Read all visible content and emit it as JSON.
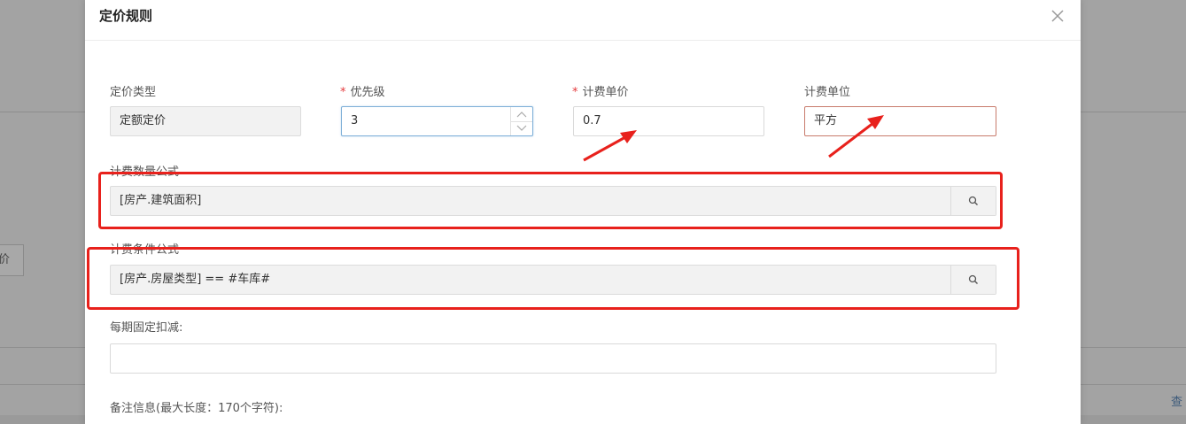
{
  "dialog": {
    "title": "定价规则",
    "close_icon": "close-icon"
  },
  "form": {
    "pricing_type": {
      "label": "定价类型",
      "value": "定额定价"
    },
    "priority": {
      "label": "优先级",
      "required_mark": "*",
      "value": "3"
    },
    "unit_price": {
      "label": "计费单价",
      "required_mark": "*",
      "value": "0.7"
    },
    "billing_unit": {
      "label": "计费单位",
      "value": "平方"
    },
    "quantity_formula": {
      "label": "计费数量公式",
      "value": "[房产.建筑面积]",
      "button_icon": "search-icon"
    },
    "condition_formula": {
      "label": "计费条件公式",
      "value": "[房产.房屋类型] == #车库#",
      "button_icon": "search-icon"
    },
    "fixed_deduction": {
      "label": "每期固定扣减:",
      "value": ""
    },
    "remarks": {
      "label": "备注信息(最大长度：170个字符):"
    }
  },
  "background": {
    "tab_label": "价",
    "link_label": "查"
  },
  "annotations": {
    "highlight_color": "#e8211c"
  }
}
